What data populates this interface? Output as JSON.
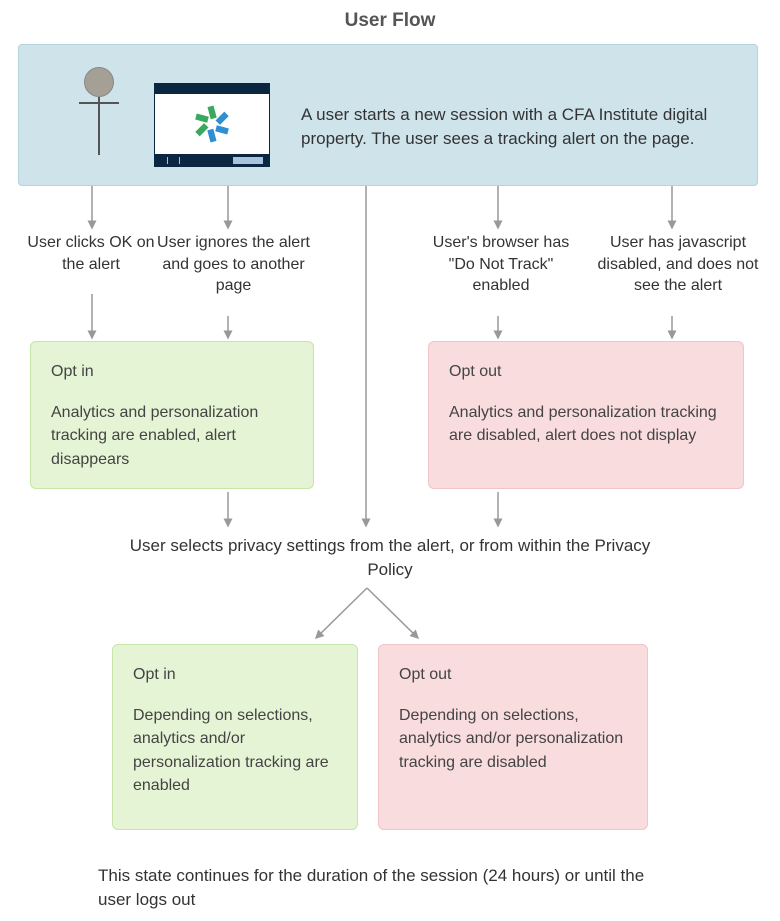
{
  "title": "User Flow",
  "start_text": "A user starts a new session with a CFA Institute digital property. The user sees a tracking alert on the page.",
  "branches": {
    "b1": "User clicks OK on the alert",
    "b2": "User ignores the alert and goes to another page",
    "b3": "User's browser has \"Do Not Track\" enabled",
    "b4": "User has javascript disabled, and does not see the alert"
  },
  "optin1": {
    "title": "Opt in",
    "body": "Analytics and personalization tracking are enabled, alert disappears"
  },
  "optout1": {
    "title": "Opt out",
    "body": "Analytics and personalization tracking are disabled, alert does not display"
  },
  "mid_label": "User selects privacy settings from the alert, or from within the Privacy Policy",
  "optin2": {
    "title": "Opt in",
    "body": "Depending on selections, analytics and/or personalization tracking are enabled"
  },
  "optout2": {
    "title": "Opt out",
    "body": "Depending on selections, analytics and/or personalization tracking are disabled"
  },
  "footnote": "This state continues for the duration of the session (24 hours) or until the user logs out"
}
